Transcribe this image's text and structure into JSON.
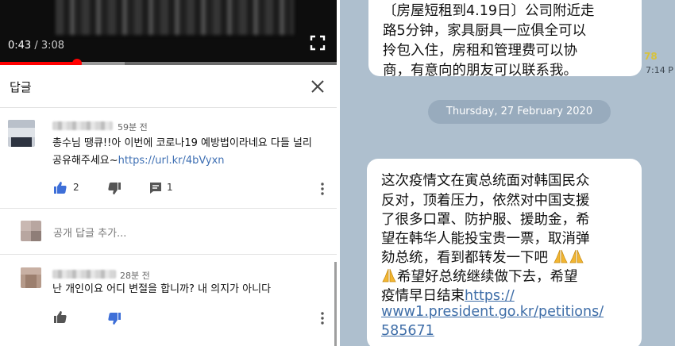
{
  "video": {
    "current_time": "0:43",
    "separator": " / ",
    "duration": "3:08",
    "progress_fraction": 0.229,
    "buffered_fraction": 0.37
  },
  "reply_panel": {
    "title": "답글",
    "close_icon": "close-icon"
  },
  "comments": [
    {
      "time": "59분 전",
      "text": "총수님 땡큐!!아 이번에 코로나19  예방법이라네요 다들 널리",
      "text2": "공유해주세요~",
      "link": "https://url.kr/4bVyxn",
      "likes": "2",
      "replies": "1"
    },
    {
      "time": "28분 전",
      "text": "난 개인이요 어디 변절을 합니까? 내 의지가 아니다"
    }
  ],
  "add_reply_placeholder": "공개 답글 추가...",
  "chat": {
    "msg1_lines": [
      "〔房屋短租到4.19日〕公司附近走",
      "路5分钟，家具厨具一应俱全可以",
      "拎包入住，房租和管理费可以协",
      "商，有意向的朋友可以联系我。"
    ],
    "read_count": "78",
    "msg1_time": "7:14 P",
    "date": "Thursday, 27 February 2020",
    "msg2_lines": [
      "这次疫情文在寅总统面对韩国民众",
      "反对，顶着压力，依然对中国支援",
      "了很多口罩、防护服、援助金，希",
      "望在韩华人能投宝贵一票，取消弹",
      "劾总统，看到都转发一下吧"
    ],
    "msg2_line6": "希望好总统继续做下去，希望",
    "msg2_line7": "疫情早日结束",
    "msg2_link1": "https://",
    "msg2_link2": "www1.president.go.kr/petitions/",
    "msg2_link3": "585671"
  },
  "colors": {
    "accent_red": "#ff0000",
    "link_blue": "#3e6fb3",
    "chat_bg": "#aebfce",
    "date_pill": "#98abbd"
  }
}
